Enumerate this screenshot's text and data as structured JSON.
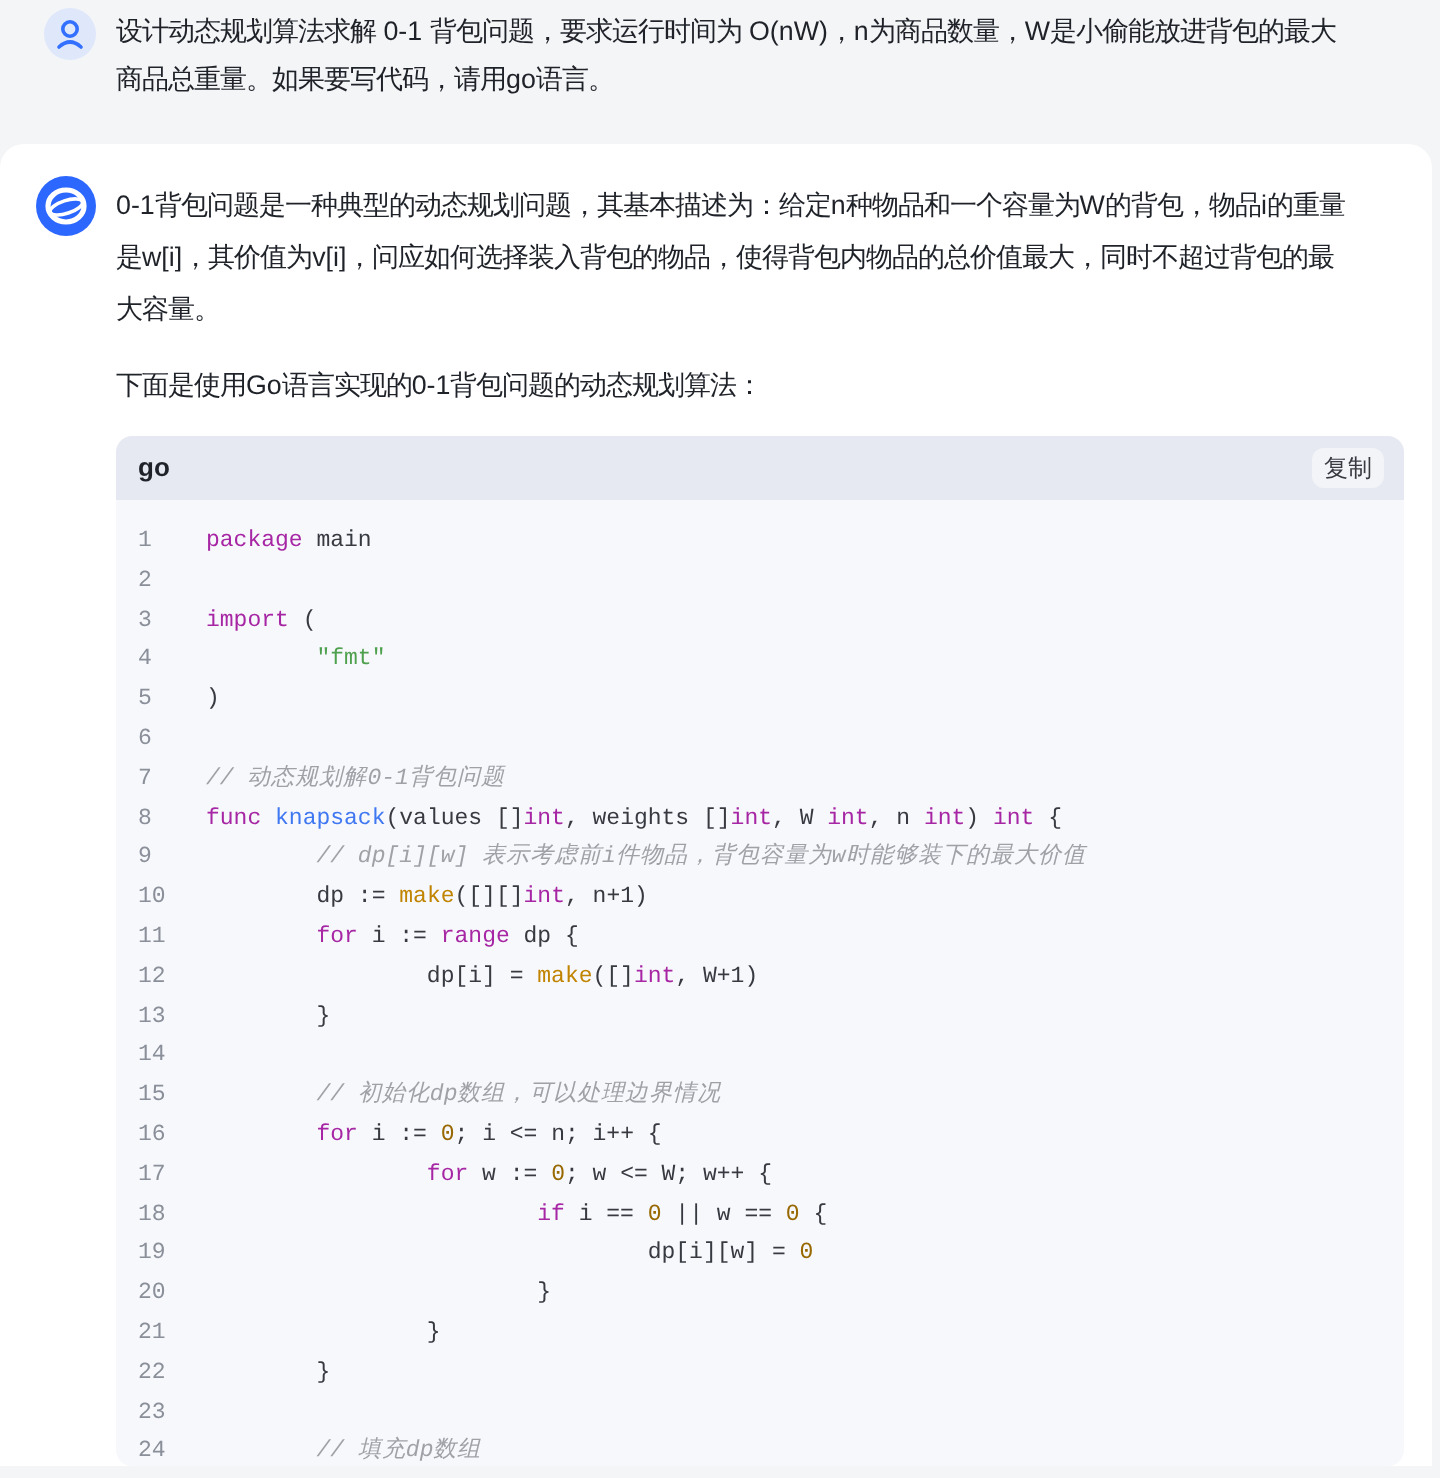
{
  "user_message": {
    "text": "设计动态规划算法求解 0-1 背包问题，要求运行时间为 O(nW)，n为商品数量，W是小偷能放进背包的最大商品总重量。如果要写代码，请用go语言。"
  },
  "assistant_message": {
    "paragraphs": [
      "0-1背包问题是一种典型的动态规划问题，其基本描述为：给定n种物品和一个容量为W的背包，物品i的重量是w[i]，其价值为v[i]，问应如何选择装入背包的物品，使得背包内物品的总价值最大，同时不超过背包的最大容量。",
      "下面是使用Go语言实现的0-1背包问题的动态规划算法："
    ],
    "code_block": {
      "language": "go",
      "copy_label": "复制",
      "lines": [
        {
          "number": "1",
          "tokens": [
            {
              "kind": "keyword",
              "text": "package"
            },
            {
              "kind": "plain",
              "text": " main"
            }
          ]
        },
        {
          "number": "2"
        },
        {
          "number": "3",
          "tokens": [
            {
              "kind": "keyword",
              "text": "import"
            },
            {
              "kind": "plain",
              "text": " ("
            }
          ]
        },
        {
          "number": "4",
          "tokens": [
            {
              "kind": "string",
              "text": "\t\"fmt\""
            }
          ]
        },
        {
          "number": "5",
          "tokens": [
            {
              "kind": "plain",
              "text": ")"
            }
          ]
        },
        {
          "number": "6"
        },
        {
          "number": "7",
          "tokens": [
            {
              "kind": "comment",
              "text": "// 动态规划解0-1背包问题"
            }
          ]
        },
        {
          "number": "8",
          "tokens": [
            {
              "kind": "keyword",
              "text": "func"
            },
            {
              "kind": "function",
              "text": " knapsack"
            },
            {
              "kind": "plain",
              "text": "(values []"
            },
            {
              "kind": "type",
              "text": "int"
            },
            {
              "kind": "plain",
              "text": ", weights []"
            },
            {
              "kind": "type",
              "text": "int"
            },
            {
              "kind": "plain",
              "text": ", W "
            },
            {
              "kind": "type",
              "text": "int"
            },
            {
              "kind": "plain",
              "text": ", n "
            },
            {
              "kind": "type",
              "text": "int"
            },
            {
              "kind": "plain",
              "text": ") "
            },
            {
              "kind": "type",
              "text": "int"
            },
            {
              "kind": "plain",
              "text": " {"
            }
          ]
        },
        {
          "number": "9",
          "tokens": [
            {
              "kind": "comment",
              "text": "\t// dp[i][w] 表示考虑前i件物品，背包容量为w时能够装下的最大价值"
            }
          ]
        },
        {
          "number": "10",
          "tokens": [
            {
              "kind": "plain",
              "text": "\tdp := "
            },
            {
              "kind": "builtin",
              "text": "make"
            },
            {
              "kind": "plain",
              "text": "([][]"
            },
            {
              "kind": "type",
              "text": "int"
            },
            {
              "kind": "plain",
              "text": ", n+1)"
            }
          ]
        },
        {
          "number": "11",
          "tokens": [
            {
              "kind": "keyword",
              "text": "\tfor"
            },
            {
              "kind": "plain",
              "text": " i := "
            },
            {
              "kind": "keyword",
              "text": "range"
            },
            {
              "kind": "plain",
              "text": " dp {"
            }
          ]
        },
        {
          "number": "12",
          "tokens": [
            {
              "kind": "plain",
              "text": "\t\tdp[i] = "
            },
            {
              "kind": "builtin",
              "text": "make"
            },
            {
              "kind": "plain",
              "text": "([]"
            },
            {
              "kind": "type",
              "text": "int"
            },
            {
              "kind": "plain",
              "text": ", W+1)"
            }
          ]
        },
        {
          "number": "13",
          "tokens": [
            {
              "kind": "plain",
              "text": "\t}"
            }
          ]
        },
        {
          "number": "14"
        },
        {
          "number": "15",
          "tokens": [
            {
              "kind": "comment",
              "text": "\t// 初始化dp数组，可以处理边界情况"
            }
          ]
        },
        {
          "number": "16",
          "tokens": [
            {
              "kind": "keyword",
              "text": "\tfor"
            },
            {
              "kind": "plain",
              "text": " i := "
            },
            {
              "kind": "number",
              "text": "0"
            },
            {
              "kind": "plain",
              "text": "; i <= n; i++ {"
            }
          ]
        },
        {
          "number": "17",
          "tokens": [
            {
              "kind": "keyword",
              "text": "\t\tfor"
            },
            {
              "kind": "plain",
              "text": " w := "
            },
            {
              "kind": "number",
              "text": "0"
            },
            {
              "kind": "plain",
              "text": "; w <= W; w++ {"
            }
          ]
        },
        {
          "number": "18",
          "tokens": [
            {
              "kind": "keyword",
              "text": "\t\t\tif"
            },
            {
              "kind": "plain",
              "text": " i == "
            },
            {
              "kind": "number",
              "text": "0"
            },
            {
              "kind": "plain",
              "text": " || w == "
            },
            {
              "kind": "number",
              "text": "0"
            },
            {
              "kind": "plain",
              "text": " {"
            }
          ]
        },
        {
          "number": "19",
          "tokens": [
            {
              "kind": "plain",
              "text": "\t\t\t\tdp[i][w] = "
            },
            {
              "kind": "number",
              "text": "0"
            }
          ]
        },
        {
          "number": "20",
          "tokens": [
            {
              "kind": "plain",
              "text": "\t\t\t}"
            }
          ]
        },
        {
          "number": "21",
          "tokens": [
            {
              "kind": "plain",
              "text": "\t\t}"
            }
          ]
        },
        {
          "number": "22",
          "tokens": [
            {
              "kind": "plain",
              "text": "\t}"
            }
          ]
        },
        {
          "number": "23"
        },
        {
          "number": "24",
          "tokens": [
            {
              "kind": "comment",
              "text": "\t// 填充dp数组"
            }
          ]
        }
      ]
    }
  }
}
